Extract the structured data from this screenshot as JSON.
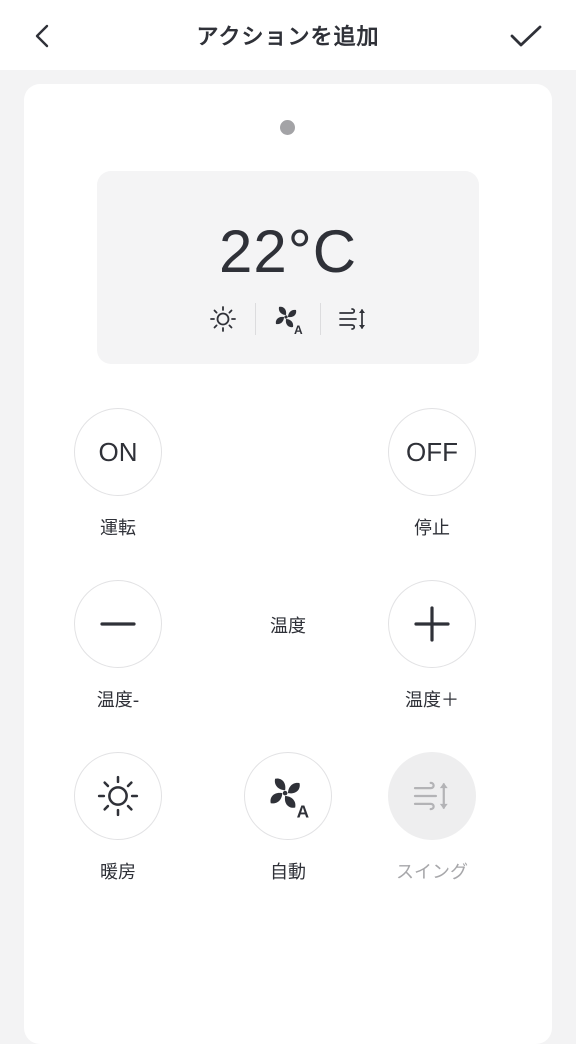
{
  "header": {
    "title": "アクションを追加",
    "back_icon": "chevron-left-icon",
    "confirm_icon": "checkmark-icon"
  },
  "display": {
    "temperature": "22°C",
    "mode_icons": [
      "sun-icon",
      "fan-auto-icon",
      "swing-icon"
    ]
  },
  "controls": {
    "on": {
      "button": "ON",
      "label": "運転"
    },
    "off": {
      "button": "OFF",
      "label": "停止"
    },
    "temp_down": {
      "label": "温度-"
    },
    "temp_center_label": "温度",
    "temp_up": {
      "label": "温度＋"
    },
    "heat": {
      "label": "暖房"
    },
    "auto": {
      "label": "自動"
    },
    "swing": {
      "label": "スイング"
    }
  },
  "colors": {
    "text": "#2f3138",
    "muted": "#a7a7aa",
    "page_bg": "#f3f3f4",
    "card_bg": "#ffffff",
    "display_bg": "#f4f4f5"
  }
}
